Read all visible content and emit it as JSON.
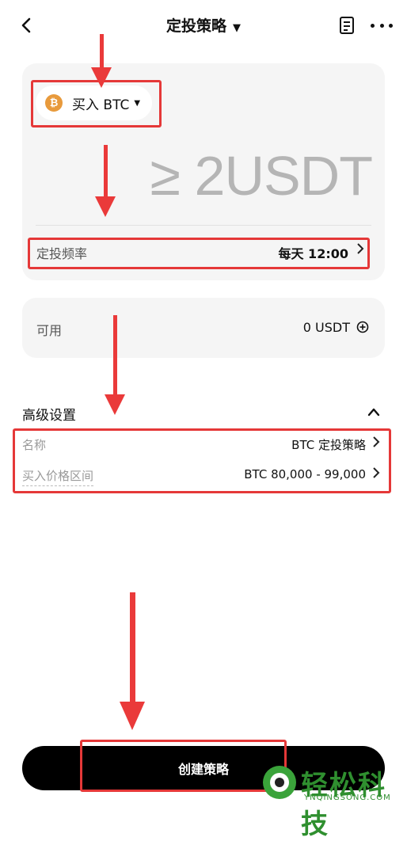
{
  "header": {
    "title": "定投策略",
    "caret": "▼",
    "back_icon": "chevron-left-icon",
    "doc_icon": "document-icon",
    "more_icon": "more-horizontal-icon"
  },
  "order": {
    "side_asset_label": "买入 BTC",
    "coin_symbol": "₿",
    "coin_color": "#e89a3c",
    "amount_display": "≥ 2USDT",
    "frequency_label": "定投频率",
    "frequency_value": "每天 12:00"
  },
  "available": {
    "label": "可用",
    "value": "0 USDT"
  },
  "advanced": {
    "title": "高级设置",
    "name_label": "名称",
    "name_value": "BTC 定投策略",
    "range_label": "买入价格区间",
    "range_value": "BTC 80,000 - 99,000"
  },
  "actions": {
    "create_label": "创建策略"
  },
  "watermark": {
    "text": "轻松科技",
    "sub": "YNQINGSONG.COM"
  },
  "colors": {
    "accent_red": "#e53838",
    "watermark_green": "#2f8f2f"
  }
}
